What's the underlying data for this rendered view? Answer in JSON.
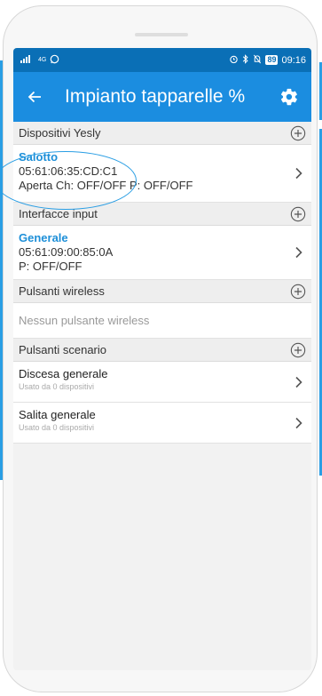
{
  "status_bar": {
    "signal_text": "4G",
    "time": "09:16",
    "battery": "89"
  },
  "app_bar": {
    "title": "Impianto tapparelle %"
  },
  "sections": {
    "yesly": {
      "title": "Dispositivi Yesly",
      "items": [
        {
          "name": "Salotto",
          "mac": "05:61:06:35:CD:C1",
          "status": "Aperta  Ch: OFF/OFF  P: OFF/OFF"
        }
      ]
    },
    "inputs": {
      "title": "Interfacce input",
      "items": [
        {
          "name": "Generale",
          "mac": "05:61:09:00:85:0A",
          "status": "P: OFF/OFF"
        }
      ]
    },
    "wireless": {
      "title": "Pulsanti wireless",
      "empty_text": "Nessun pulsante wireless"
    },
    "scenario": {
      "title": "Pulsanti scenario",
      "items": [
        {
          "name": "Discesa generale",
          "sub": "Usato da 0 dispositivi"
        },
        {
          "name": "Salita generale",
          "sub": "Usato da 0 dispositivi"
        }
      ]
    }
  },
  "colors": {
    "status_bar": "#0a6fb6",
    "app_bar": "#1b8de0",
    "accent": "#1d8fd8",
    "annotation": "#2a9ee4"
  },
  "icons": [
    "back-arrow-icon",
    "gear-icon",
    "add-circle-icon",
    "chevron-right-icon",
    "whatsapp-icon",
    "alarm-icon",
    "bluetooth-icon",
    "mute-icon",
    "signal-icon"
  ]
}
